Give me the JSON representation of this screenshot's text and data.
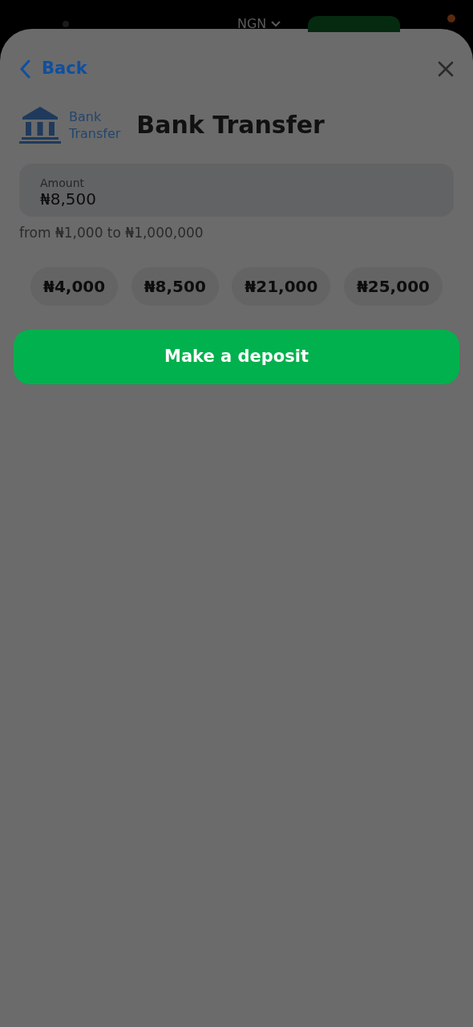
{
  "background_header": {
    "currency": "NGN"
  },
  "sheet": {
    "back": "Back",
    "logo_text": [
      "Bank",
      "Transfer"
    ],
    "title": "Bank Transfer",
    "amount_field": {
      "label": "Amount",
      "value": "₦8,500"
    },
    "limits": "from ₦1,000 to ₦1,000,000",
    "presets": [
      {
        "label": "₦4,000"
      },
      {
        "label": "₦8,500"
      },
      {
        "label": "₦21,000"
      },
      {
        "label": "₦25,000"
      }
    ],
    "submit": "Make a deposit"
  }
}
